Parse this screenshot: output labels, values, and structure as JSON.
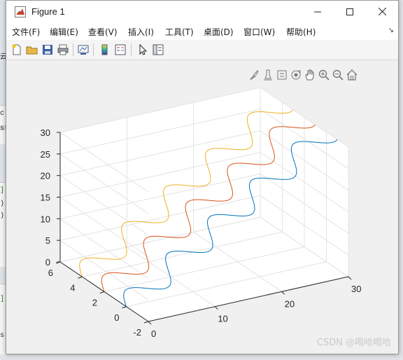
{
  "window": {
    "title": "Figure 1"
  },
  "menu": [
    "文件(F)",
    "编辑(E)",
    "查看(V)",
    "插入(I)",
    "工具(T)",
    "桌面(D)",
    "窗口(W)",
    "帮助(H)"
  ],
  "toolbar_icons": [
    "new-figure-icon",
    "open-folder-icon",
    "save-icon",
    "print-icon",
    "link-plot-icon",
    "colorbar-icon",
    "legend-icon",
    "pointer-icon",
    "property-inspector-icon"
  ],
  "axes_toolbar_icons": [
    "brush-icon",
    "data-tips-icon",
    "export-icon",
    "rotate-3d-icon",
    "pan-icon",
    "zoom-in-icon",
    "zoom-out-icon",
    "home-icon"
  ],
  "background_text": [
    "云",
    "c",
    "st",
    "]",
    ")",
    ")",
    "]",
    "s:"
  ],
  "chart_data": {
    "type": "line",
    "dimensions": "3d",
    "title": "",
    "xlabel": "",
    "ylabel": "",
    "zlabel": "",
    "xlim": [
      0,
      30
    ],
    "ylim": [
      -2,
      6
    ],
    "zlim": [
      0,
      30
    ],
    "x_ticks": [
      "0",
      "10",
      "20",
      "30"
    ],
    "y_ticks": [
      "-2",
      "0",
      "2",
      "4",
      "6"
    ],
    "z_ticks": [
      "0",
      "5",
      "10",
      "15",
      "20",
      "25",
      "30"
    ],
    "grid": true,
    "series": [
      {
        "color": "#0072BD",
        "x": "t",
        "y": "sin(t)",
        "z": "t",
        "t_range": [
          0,
          30
        ]
      },
      {
        "color": "#D95319",
        "x": "t",
        "y": "sin(t) + 2",
        "z": "t",
        "t_range": [
          0,
          30
        ]
      },
      {
        "color": "#EDB120",
        "x": "t",
        "y": "sin(t) + 4",
        "z": "t",
        "t_range": [
          0,
          30
        ]
      }
    ]
  },
  "watermark": "CSDN @喝哈喝哈"
}
